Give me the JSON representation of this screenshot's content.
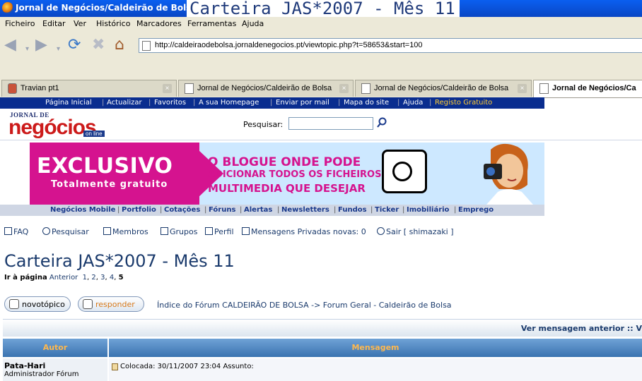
{
  "window": {
    "title": "Jornal de Negócios/Caldeirão de Bolsa -",
    "title_overlay": "Carteira JAS*2007 - Mês 11"
  },
  "menu": [
    "Ficheiro",
    "Editar",
    "Ver",
    "Histórico",
    "Marcadores",
    "Ferramentas",
    "Ajuda"
  ],
  "address": {
    "url": "http://caldeiraodebolsa.jornaldenegocios.pt/viewtopic.php?t=58653&start=100"
  },
  "tabs": [
    {
      "label": "Travian pt1"
    },
    {
      "label": "Jornal de Negócios/Caldeirão de Bolsa"
    },
    {
      "label": "Jornal de Negócios/Caldeirão de Bolsa"
    },
    {
      "label": "Jornal de Negócios/Ca"
    }
  ],
  "site_top_links": [
    "Página Inicial",
    "Actualizar",
    "Favoritos",
    "A sua Homepage",
    "Enviar por mail",
    "Mapa do site",
    "Ajuda",
    "Registo Gratuito"
  ],
  "logo": {
    "top": "JORNAL DE",
    "main": "negócios",
    "badge": "on line"
  },
  "search": {
    "label": "Pesquisar:"
  },
  "banner": {
    "exclusive": "EXCLUSIVO",
    "free": "Totalmente gratuito",
    "line1": "O BLOGUE ONDE PODE",
    "line2": "ADICIONAR TODOS OS FICHEIROS",
    "line3": "MULTIMEDIA QUE DESEJAR",
    "left_color": "#d5138f",
    "right_color": "#cde8ff"
  },
  "site_links": [
    "Negócios Mobile",
    "Portfolio",
    "Cotações",
    "Fóruns",
    "Alertas",
    "Newsletters",
    "Fundos",
    "Ticker",
    "Imobiliário",
    "Emprego"
  ],
  "forum_nav": {
    "faq": "FAQ",
    "search": "Pesquisar",
    "members": "Membros",
    "groups": "Grupos",
    "profile": "Perfil",
    "pm": "Mensagens Privadas novas: 0",
    "logout": "Sair [ shimazaki ]"
  },
  "topic": {
    "title": "Carteira JAS*2007 - Mês 11",
    "goto_label": "Ir à página",
    "prev": "Anterior",
    "p1": "1",
    "p2": "2",
    "p3": "3",
    "p4": "4",
    "p5": "5"
  },
  "buttons": {
    "new_topic": "novotópico",
    "reply": "responder"
  },
  "breadcrumb": "Índice do Fórum CALDEIRÃO DE BOLSA -> Forum Geral - Caldeirão de Bolsa",
  "prev_message": "Ver mensagem anterior :: V",
  "table": {
    "author_header": "Autor",
    "message_header": "Mensagem"
  },
  "post": {
    "author": "Pata-Hari",
    "role": "Administrador Fórum",
    "meta": "Colocada: 30/11/2007 23:04    Assunto:"
  }
}
